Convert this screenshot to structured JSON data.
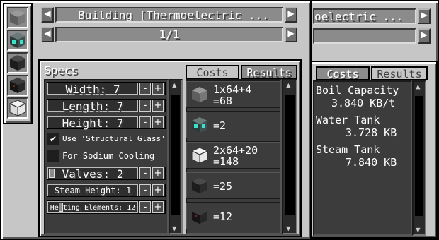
{
  "header": {
    "prev_glyph": "◀",
    "next_glyph": "▶",
    "title": "Building [Thermoelectric ...",
    "title_behind": "oelectric ...",
    "page_indicator": "1/1"
  },
  "sidebar": {
    "items": [
      {
        "icon": "casing-block-icon"
      },
      {
        "icon": "controller-block-icon"
      },
      {
        "icon": "valve-block-icon"
      },
      {
        "icon": "heating-element-block-icon"
      },
      {
        "icon": "glass-block-icon"
      }
    ]
  },
  "specs": {
    "heading": "Specs",
    "width_label": "Width: 7",
    "length_label": "Length: 7",
    "height_label": "Height: 7",
    "structural_glass_label": "Use 'Structural Glass'",
    "structural_glass_checked": true,
    "structural_glass_check": "✔",
    "sodium_cooling_label": "For Sodium Cooling",
    "sodium_cooling_checked": false,
    "valves_label": "Valves: 2",
    "steam_height_label": "Steam Height: 1",
    "heating_elements_label": "Heating Elements: 12",
    "minus": "-",
    "plus": "+"
  },
  "tabs": {
    "costs": "Costs",
    "results": "Results"
  },
  "costs": [
    {
      "line1": "1x64+4",
      "line2": "=68",
      "icon": "casing-block-icon"
    },
    {
      "line1": "=2",
      "line2": "",
      "icon": "controller-block-icon"
    },
    {
      "line1": "2x64+20",
      "line2": "=148",
      "icon": "glass-block-icon"
    },
    {
      "line1": "=25",
      "line2": "",
      "icon": "valve-block-icon"
    },
    {
      "line1": "=12",
      "line2": "",
      "icon": "heating-element-block-icon"
    }
  ],
  "results": {
    "boil_capacity_label": "Boil Capacity",
    "boil_capacity_value": "3.840 KB/t",
    "water_tank_label": "Water Tank",
    "water_tank_value": "3.728 KB",
    "steam_tank_label": "Steam Tank",
    "steam_tank_value": "7.840 KB"
  },
  "scroll": {
    "up": "▲",
    "down": "▼"
  },
  "colors": {
    "panel": "#c6c6c6",
    "dark_slot": "#2a2a2a",
    "text": "#ffffff"
  }
}
